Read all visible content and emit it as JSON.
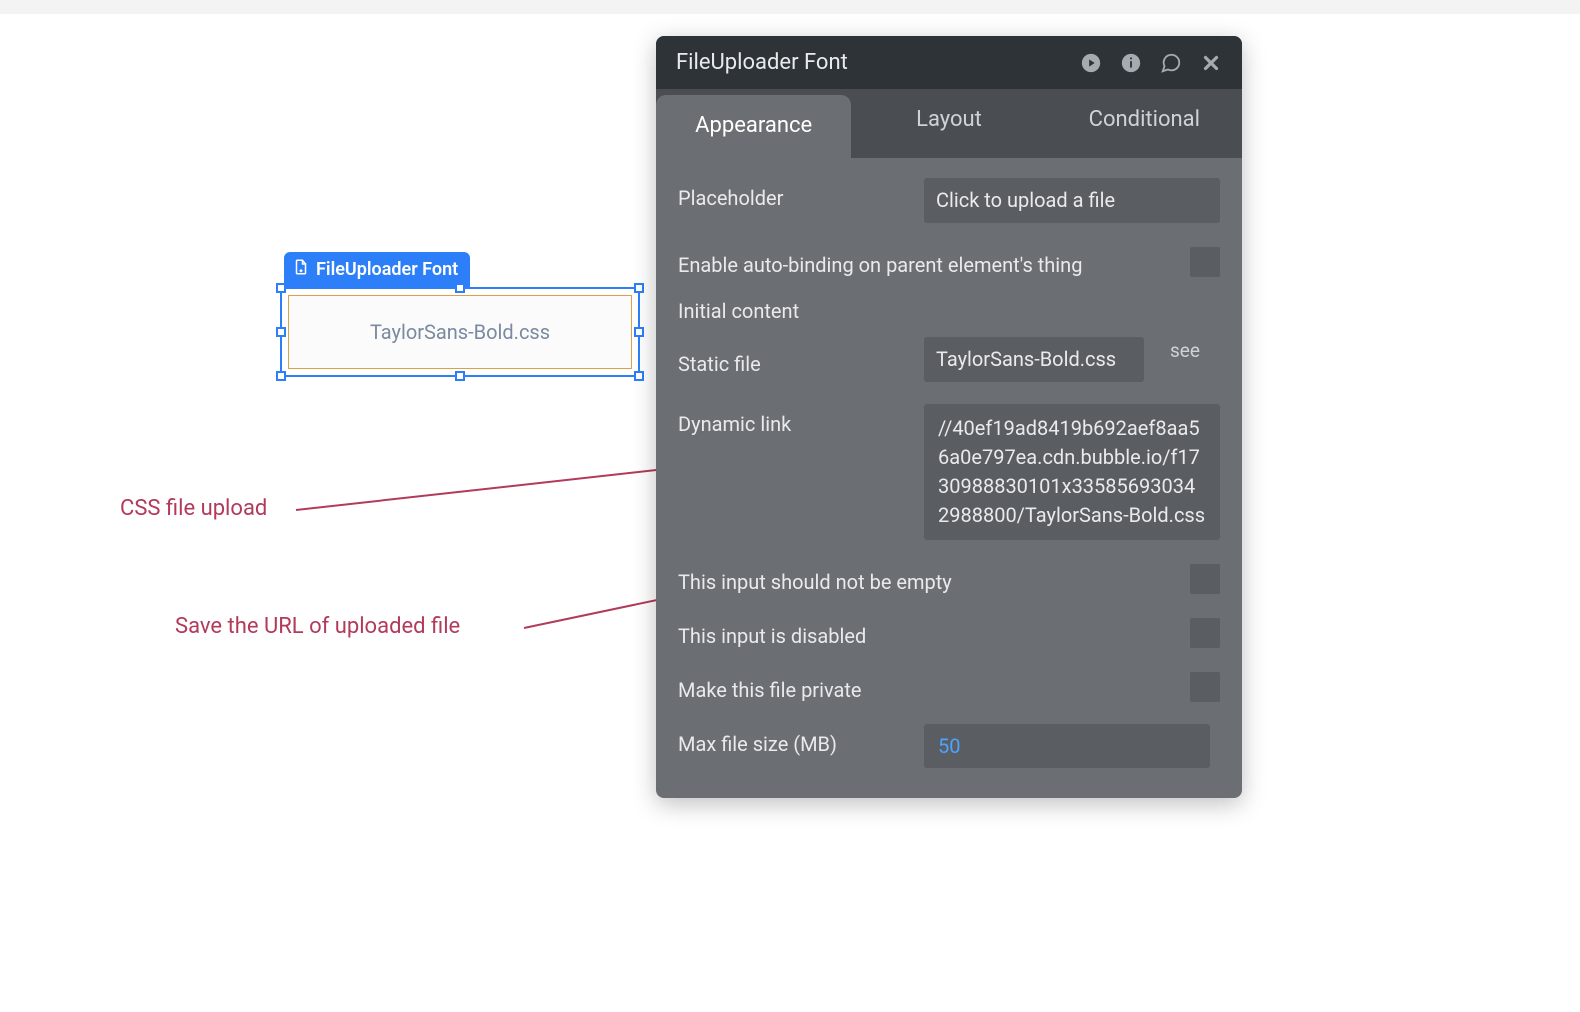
{
  "canvas": {
    "element_label": "FileUploader Font",
    "display_value": "TaylorSans-Bold.css"
  },
  "annotations": {
    "css_upload": "CSS file upload",
    "save_url": "Save the URL of uploaded file"
  },
  "panel": {
    "title": "FileUploader Font",
    "tabs": {
      "appearance": "Appearance",
      "layout": "Layout",
      "conditional": "Conditional"
    },
    "fields": {
      "placeholder_label": "Placeholder",
      "placeholder_value": "Click to upload a file",
      "auto_binding_label": "Enable auto-binding on parent element's thing",
      "initial_content_label": "Initial content",
      "static_file_label": "Static file",
      "static_file_value": "TaylorSans-Bold.css",
      "see_label": "see",
      "dynamic_link_label": "Dynamic link",
      "dynamic_link_value": "//40ef19ad8419b692aef8aa56a0e797ea.cdn.bubble.io/f1730988830101x335856930342988800/TaylorSans-Bold.css",
      "not_empty_label": "This input should not be empty",
      "disabled_label": "This input is disabled",
      "private_label": "Make this file private",
      "max_size_label": "Max file size (MB)",
      "max_size_value": "50"
    }
  }
}
